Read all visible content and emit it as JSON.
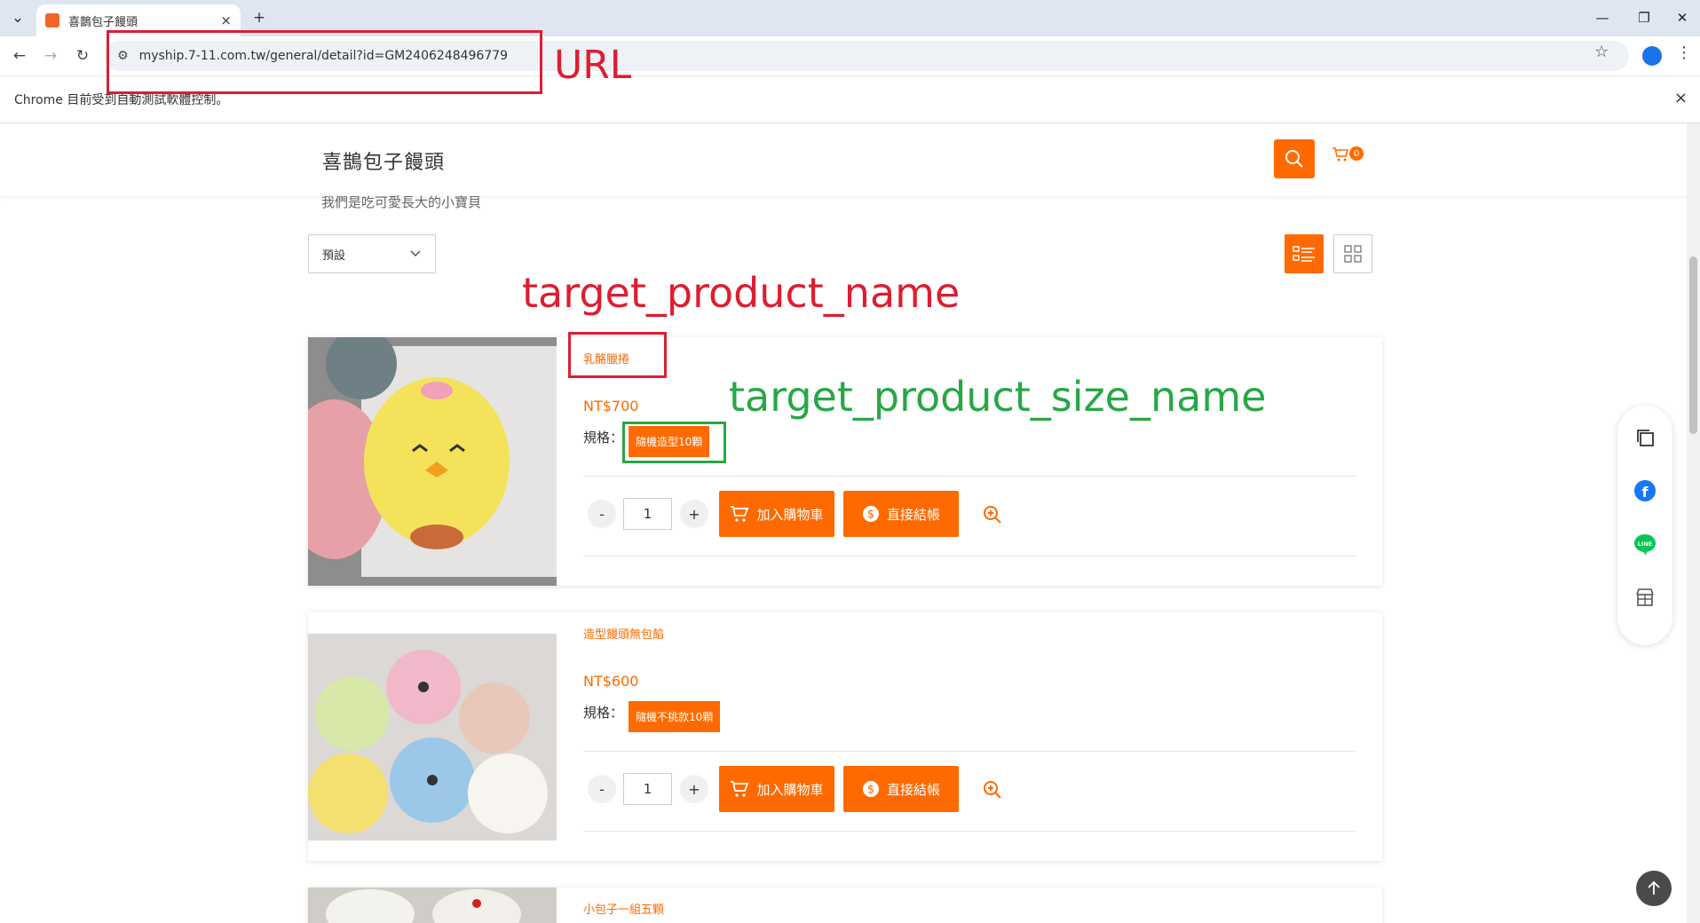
{
  "browser": {
    "tab_title": "喜鵲包子饅頭",
    "tab_close": "×",
    "new_tab": "+",
    "url": "myship.7-11.com.tw/general/detail?id=GM2406248496779",
    "infobar_text": "Chrome 目前受到自動測試軟體控制。",
    "infobar_close": "×"
  },
  "header": {
    "store_name": "喜鵲包子饅頭",
    "cart_count": "0",
    "tagline": "我們是吃可愛長大的小寶貝"
  },
  "toolbar": {
    "sort_selected": "預設"
  },
  "annotations": {
    "url_label": "URL",
    "product_name_label": "target_product_name",
    "size_name_label": "target_product_size_name"
  },
  "products": [
    {
      "name": "乳酪臘捲",
      "price": "NT$700",
      "spec_label": "規格：",
      "spec_value": "隨機造型10顆",
      "qty_minus": "-",
      "qty": "1",
      "qty_plus": "+",
      "add_to_cart": "加入購物車",
      "checkout": "直接結帳"
    },
    {
      "name": "造型饅頭無包餡",
      "price": "NT$600",
      "spec_label": "規格：",
      "spec_value": "隨機不挑款10顆",
      "qty_minus": "-",
      "qty": "1",
      "qty_plus": "+",
      "add_to_cart": "加入購物車",
      "checkout": "直接結帳"
    },
    {
      "name": "小包子一組五顆"
    }
  ],
  "colors": {
    "accent": "#ff6a00",
    "annotation_red": "#dc1e32",
    "annotation_green": "#28a745"
  }
}
